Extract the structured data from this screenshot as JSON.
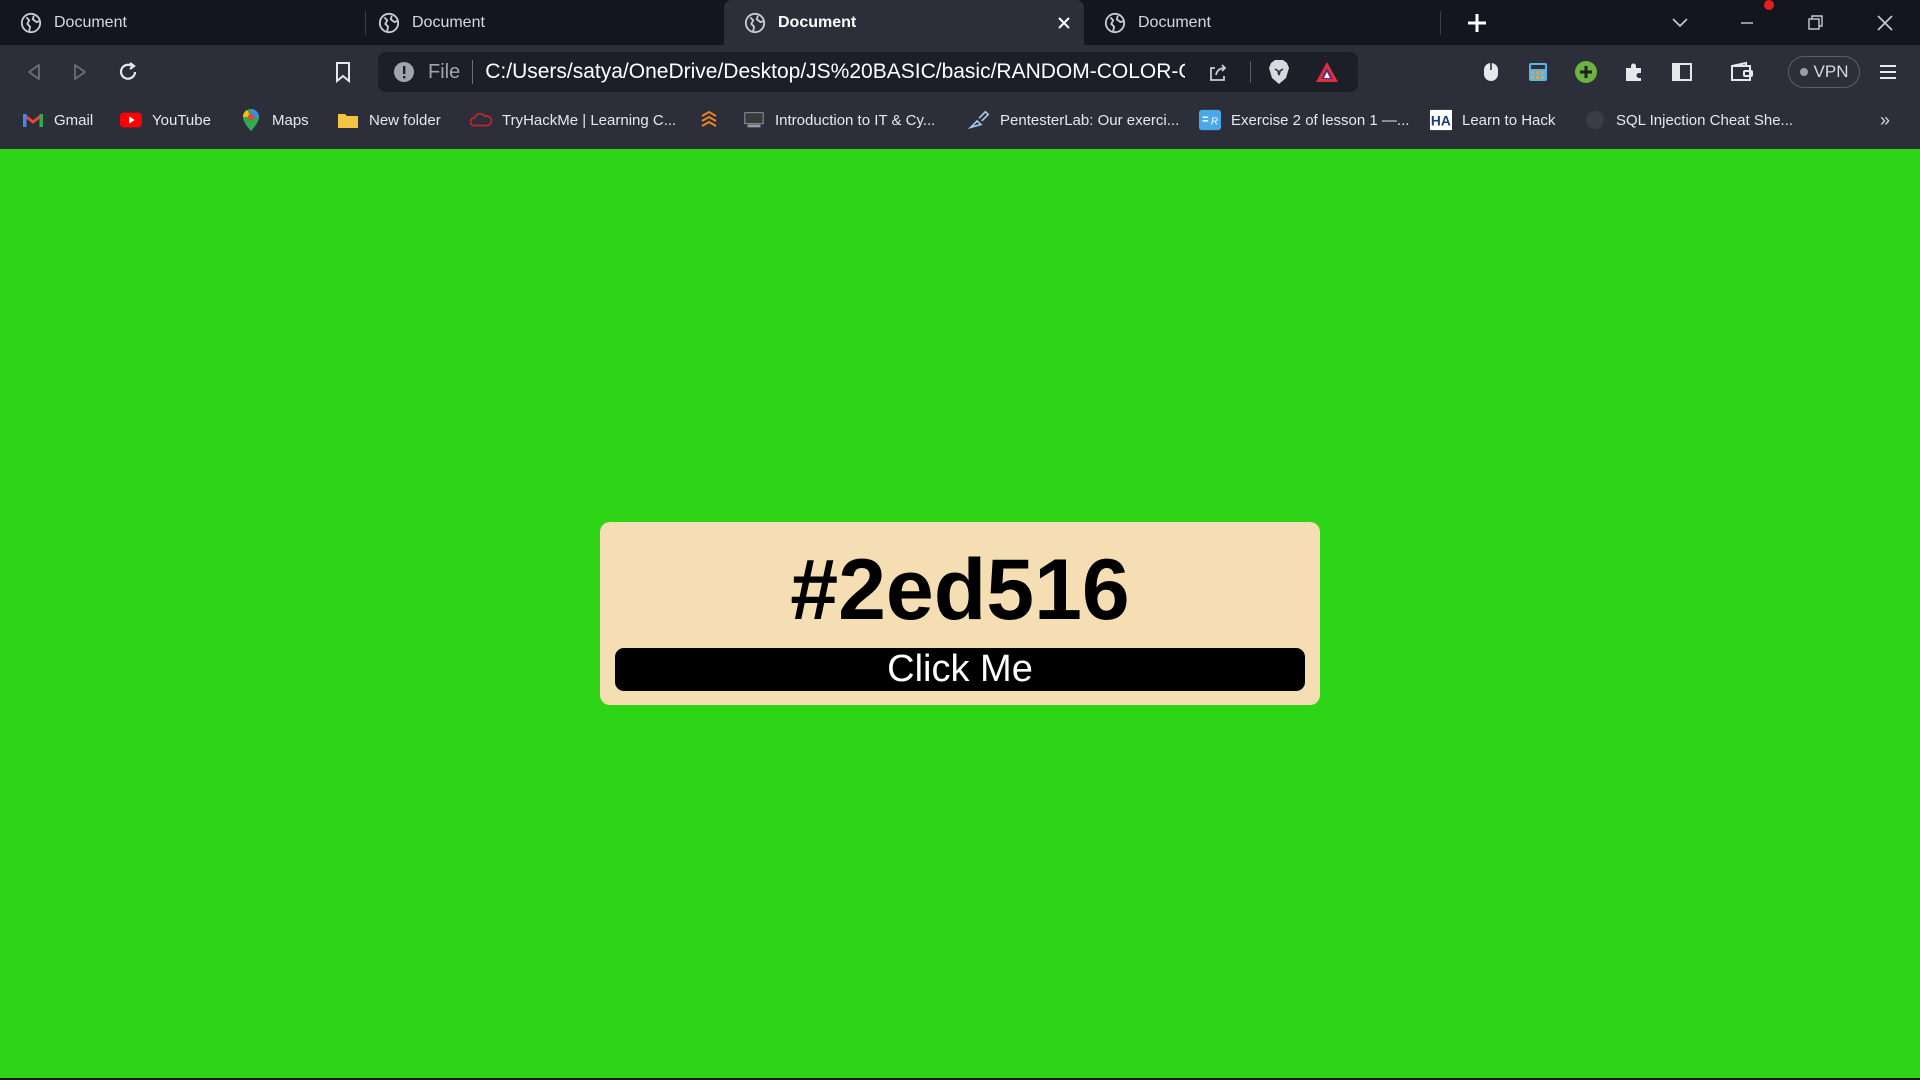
{
  "tabs": [
    {
      "title": "Document",
      "active": false
    },
    {
      "title": "Document",
      "active": false
    },
    {
      "title": "Document",
      "active": true
    },
    {
      "title": "Document",
      "active": false
    }
  ],
  "address_bar": {
    "scheme_label": "File",
    "url": "C:/Users/satya/OneDrive/Desktop/JS%20BASIC/basic/RANDOM-COLOR-G..."
  },
  "vpn_label": "VPN",
  "bookmarks": [
    {
      "label": "Gmail",
      "icon": "gmail-icon"
    },
    {
      "label": "YouTube",
      "icon": "youtube-icon"
    },
    {
      "label": "Maps",
      "icon": "maps-icon"
    },
    {
      "label": "New folder",
      "icon": "folder-icon"
    },
    {
      "label": "TryHackMe | Learning C...",
      "icon": "tryhackme-icon"
    },
    {
      "label": "",
      "icon": "stack-icon"
    },
    {
      "label": "Introduction to IT & Cy...",
      "icon": "cybrary-icon"
    },
    {
      "label": "PentesterLab: Our exerci...",
      "icon": "pentesterlab-icon"
    },
    {
      "label": "Exercise 2 of lesson 1 —...",
      "icon": "exercise-icon"
    },
    {
      "label": "Learn to Hack",
      "icon": "hacksplaining-icon"
    },
    {
      "label": "SQL Injection Cheat She...",
      "icon": "sqli-icon"
    }
  ],
  "page": {
    "hex_code": "#2ed516",
    "button_label": "Click Me",
    "background_color": "#2ed516",
    "card_color": "#f5deb3"
  }
}
